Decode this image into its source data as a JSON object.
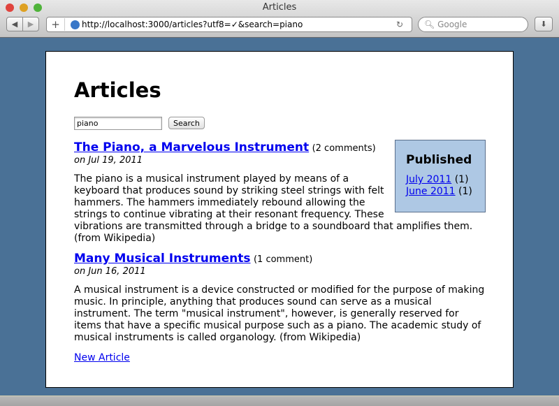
{
  "window": {
    "title": "Articles",
    "url": "http://localhost:3000/articles?utf8=✓&search=piano",
    "search_placeholder": "Google"
  },
  "page": {
    "heading": "Articles",
    "search": {
      "value": "piano",
      "button": "Search"
    },
    "sidebar": {
      "title": "Published",
      "items": [
        {
          "label": "July 2011",
          "count": "(1)"
        },
        {
          "label": "June 2011",
          "count": "(1)"
        }
      ]
    },
    "articles": [
      {
        "title": "The Piano, a Marvelous Instrument",
        "comments": "(2 comments)",
        "date": "on Jul 19, 2011",
        "body": "The piano is a musical instrument played by means of a keyboard that produces sound by striking steel strings with felt hammers. The hammers immediately rebound allowing the strings to continue vibrating at their resonant frequency. These vibrations are transmitted through a bridge to a soundboard that amplifies them. (from Wikipedia)"
      },
      {
        "title": "Many Musical Instruments",
        "comments": "(1 comment)",
        "date": "on Jun 16, 2011",
        "body": "A musical instrument is a device constructed or modified for the purpose of making music. In principle, anything that produces sound can serve as a musical instrument. The term \"musical instrument\", however, is generally reserved for items that have a specific musical purpose such as a piano. The academic study of musical instruments is called organology. (from Wikipedia)"
      }
    ],
    "new_article": "New Article"
  }
}
